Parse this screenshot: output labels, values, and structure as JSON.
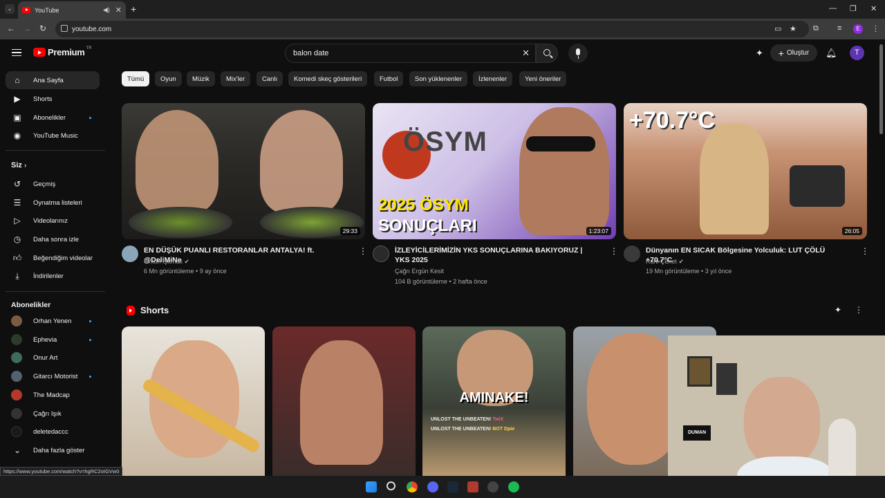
{
  "browser": {
    "tab_title": "YouTube",
    "url": "youtube.com",
    "profile_initial": "E",
    "status_url": "https://www.youtube.com/watch?v=hgRC2oIGVw0"
  },
  "header": {
    "logo_text": "Premium",
    "logo_region": "TR",
    "search_value": "balon date",
    "create_label": "Oluştur",
    "avatar_initial": "T"
  },
  "sidebar": {
    "main": [
      {
        "label": "Ana Sayfa",
        "icon": "home-icon"
      },
      {
        "label": "Shorts",
        "icon": "shorts-icon"
      },
      {
        "label": "Abonelikler",
        "icon": "subscriptions-icon"
      },
      {
        "label": "YouTube Music",
        "icon": "music-icon"
      }
    ],
    "you_header": "Siz",
    "you": [
      {
        "label": "Geçmiş",
        "icon": "history-icon"
      },
      {
        "label": "Oynatma listeleri",
        "icon": "playlist-icon"
      },
      {
        "label": "Videolarınız",
        "icon": "your-videos-icon"
      },
      {
        "label": "Daha sonra izle",
        "icon": "watch-later-icon"
      },
      {
        "label": "Beğendiğim videolar",
        "icon": "like-icon"
      },
      {
        "label": "İndirilenler",
        "icon": "download-icon"
      }
    ],
    "subs_header": "Abonelikler",
    "subs": [
      {
        "label": "Orhan Yenen",
        "color": "#7a5c44"
      },
      {
        "label": "Ephevia",
        "color": "#2d3b2d"
      },
      {
        "label": "Onur Art",
        "color": "#3f6b5a"
      },
      {
        "label": "Gitarcı Motorist",
        "color": "#556070"
      },
      {
        "label": "The Madcap",
        "color": "#b33a2a"
      },
      {
        "label": "Çağrı Işık",
        "color": "#333333"
      },
      {
        "label": "deletedaccc",
        "color": "#1a1a1a"
      }
    ],
    "show_more": "Daha fazla göster"
  },
  "chips": [
    "Tümü",
    "Oyun",
    "Müzik",
    "Mix'ler",
    "Canlı",
    "Komedi skeç gösterileri",
    "Futbol",
    "Son yüklenenler",
    "İzlenenler",
    "Yeni öneriler"
  ],
  "videos": [
    {
      "title": "EN DÜŞÜK PUANLI RESTORANLAR ANTALYA! ft. @DeliMiNe",
      "channel": "Orkun Işıtmak",
      "meta": "6 Mn görüntüleme • 9 ay önce",
      "duration": "29:33"
    },
    {
      "title": "İZLEYİCİLERİMİZİN YKS SONUÇLARINA BAKIYORUZ | YKS 2025",
      "channel": "Çağrı Ergün Kesit",
      "meta": "104 B görüntüleme • 2 hafta önce",
      "duration": "1:23:07",
      "thumb_text_1": "2025 ÖSYM",
      "thumb_text_2": "SONUÇLARI",
      "thumb_logo": "ÖSYM"
    },
    {
      "title": "Dünyanın EN SICAK Bölgesine Yolculuk: LUT ÇÖLÜ +70.7°C",
      "channel": "Ruhi Çenet",
      "meta": "19 Mn görüntüleme • 3 yıl önce",
      "duration": "26:05",
      "thumb_text_1": "+70.7°C"
    }
  ],
  "shorts": {
    "title": "Shorts",
    "overlay_text": "AMINAKE!",
    "game_text_1": "UNLOST THE UNBEATEN!",
    "game_text_2": "UNLOST THE UNBEATEN!",
    "game_tag_1": "TwiX",
    "game_tag_2": "BOT Dpie"
  },
  "webcam": {
    "poster_text": "DUMAN"
  }
}
